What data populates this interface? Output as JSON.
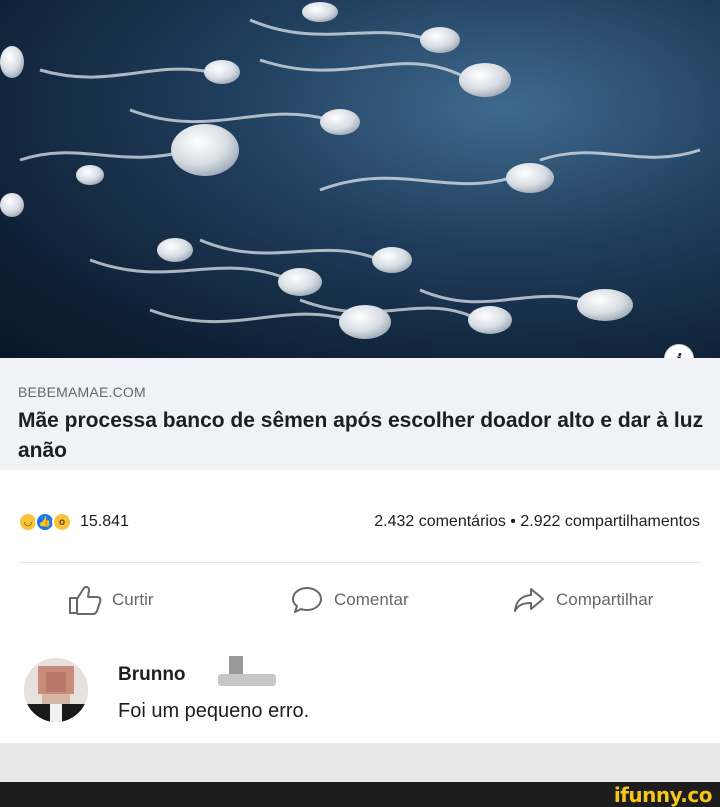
{
  "post": {
    "image_icon": "sperm-cells-photo",
    "info_icon": "info-icon",
    "info_glyph": "i",
    "link_domain": "BEBEMAMAE.COM",
    "headline": "Mãe processa banco de sêmen após escolher doador alto e dar à luz anão"
  },
  "reactions": {
    "icons": [
      "haha-icon",
      "like-icon",
      "wow-icon"
    ],
    "count": "15.841",
    "stats": "2.432 comentários • 2.922 compartilhamentos"
  },
  "actions": {
    "like_label": "Curtir",
    "comment_label": "Comentar",
    "share_label": "Compartilhar"
  },
  "comment": {
    "author": "Brunno",
    "text": "Foi um pequeno erro."
  },
  "footer": {
    "watermark": "ifunny.co"
  },
  "colors": {
    "preview_bg": "#f0f2f5",
    "like_blue": "#1877f2",
    "watermark_yellow": "#f5c518"
  }
}
